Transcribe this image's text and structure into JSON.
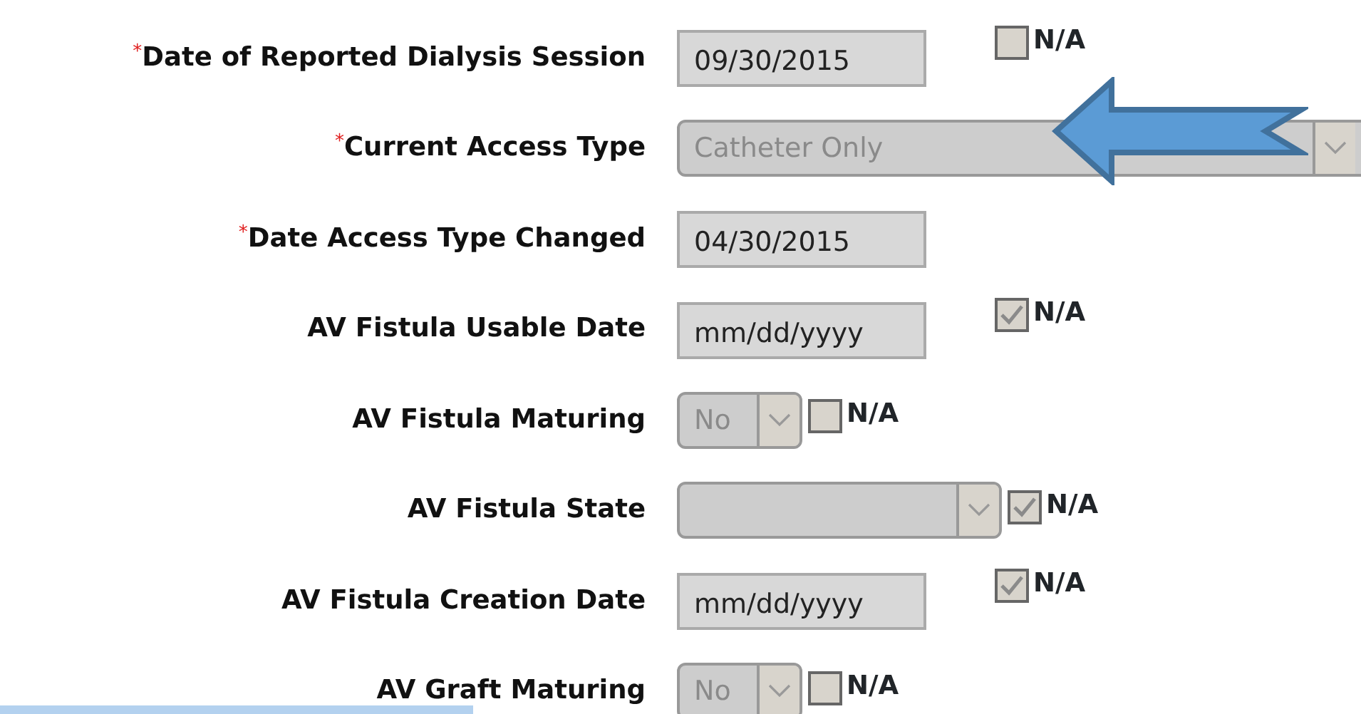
{
  "fields": [
    {
      "label": "Date of Reported Dialysis Session",
      "required_mark": "*",
      "kind": "date",
      "value": "09/30/2015",
      "na": {
        "label": "N/A",
        "checked": false
      }
    },
    {
      "label": "Current Access Type",
      "required_mark": "*",
      "kind": "wide_select",
      "value": "Catheter Only"
    },
    {
      "label": "Date Access Type Changed",
      "required_mark": "*",
      "kind": "date",
      "value": "04/30/2015"
    },
    {
      "label": "AV Fistula Usable Date",
      "kind": "date",
      "placeholder": "mm/dd/yyyy",
      "na": {
        "label": "N/A",
        "checked": true
      }
    },
    {
      "label": "AV Fistula Maturing",
      "kind": "short_select",
      "value": "No",
      "na": {
        "label": "N/A",
        "checked": false
      }
    },
    {
      "label": "AV Fistula State",
      "kind": "select",
      "na": {
        "label": "N/A",
        "checked": true
      }
    },
    {
      "label": "AV Fistula Creation Date",
      "kind": "date",
      "placeholder": "mm/dd/yyyy",
      "na": {
        "label": "N/A",
        "checked": true
      }
    },
    {
      "label": "AV Graft Maturing",
      "kind": "short_select",
      "value": "No",
      "na": {
        "label": "N/A",
        "checked": false
      }
    }
  ]
}
